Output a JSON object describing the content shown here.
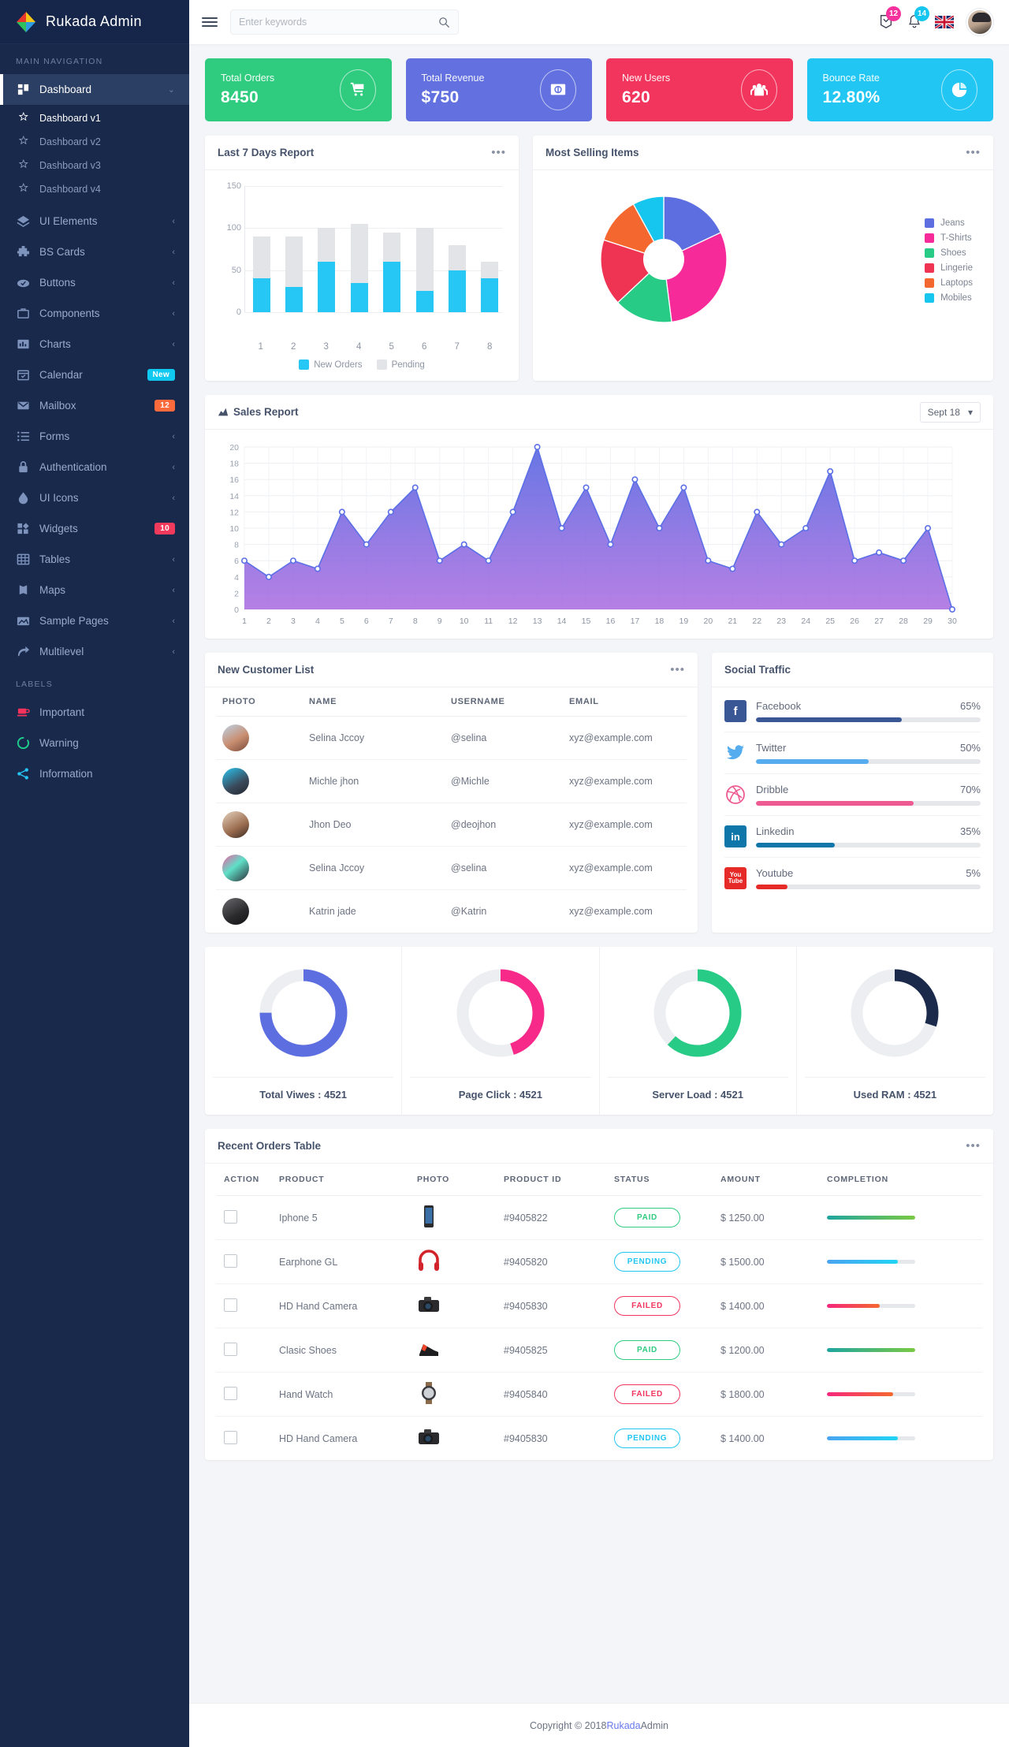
{
  "brand": {
    "title": "Rukada Admin",
    "logo_icon": "diamond-logo-icon"
  },
  "sidebar": {
    "nav_header": "MAIN NAVIGATION",
    "labels_header": "LABELS",
    "items": [
      {
        "label": "Dashboard",
        "icon": "dashboard-icon",
        "active": true,
        "caret": "⌄",
        "children": [
          {
            "label": "Dashboard v1",
            "icon": "star-icon",
            "active": true
          },
          {
            "label": "Dashboard v2",
            "icon": "star-icon",
            "active": false
          },
          {
            "label": "Dashboard v3",
            "icon": "star-icon",
            "active": false
          },
          {
            "label": "Dashboard v4",
            "icon": "star-icon",
            "active": false
          }
        ]
      },
      {
        "label": "UI Elements",
        "icon": "layers-icon",
        "caret": "‹"
      },
      {
        "label": "BS Cards",
        "icon": "puzzle-icon",
        "caret": "‹"
      },
      {
        "label": "Buttons",
        "icon": "cloud-check-icon",
        "caret": "‹"
      },
      {
        "label": "Components",
        "icon": "briefcase-icon",
        "caret": "‹"
      },
      {
        "label": "Charts",
        "icon": "bar-chart-icon",
        "caret": "‹"
      },
      {
        "label": "Calendar",
        "icon": "calendar-icon",
        "badge": "New",
        "badge_color": "#0fc9f0"
      },
      {
        "label": "Mailbox",
        "icon": "envelope-icon",
        "badge": "12",
        "badge_color": "#fd6a3b"
      },
      {
        "label": "Forms",
        "icon": "list-icon",
        "caret": "‹"
      },
      {
        "label": "Authentication",
        "icon": "lock-icon",
        "caret": "‹"
      },
      {
        "label": "UI Icons",
        "icon": "droplet-icon",
        "caret": "‹"
      },
      {
        "label": "Widgets",
        "icon": "widgets-icon",
        "badge": "10",
        "badge_color": "#f23a5c"
      },
      {
        "label": "Tables",
        "icon": "table-icon",
        "caret": "‹"
      },
      {
        "label": "Maps",
        "icon": "map-icon",
        "caret": "‹"
      },
      {
        "label": "Sample Pages",
        "icon": "images-icon",
        "caret": "‹"
      },
      {
        "label": "Multilevel",
        "icon": "arrow-forward-icon",
        "caret": "‹"
      }
    ],
    "labels": [
      {
        "label": "Important",
        "icon": "coffee-icon",
        "color": "#f5325c"
      },
      {
        "label": "Warning",
        "icon": "circle-notch-icon",
        "color": "#1fc98a"
      },
      {
        "label": "Information",
        "icon": "share-icon",
        "color": "#24c6f5"
      }
    ]
  },
  "topbar": {
    "menu_icon": "hamburger-icon",
    "search": {
      "placeholder": "Enter keywords",
      "value": "",
      "icon": "search-icon"
    },
    "mail": {
      "icon": "mail-icon",
      "badge": "12",
      "badge_color": "#f5319d"
    },
    "bell": {
      "icon": "bell-icon",
      "badge": "14",
      "badge_color": "#17c6ef"
    },
    "flag": {
      "icon": "uk-flag-icon"
    },
    "avatar": {
      "icon": "user-avatar"
    }
  },
  "stats": [
    {
      "title": "Total Orders",
      "value": "8450",
      "color": "#2fcb7f",
      "icon": "cart-icon"
    },
    {
      "title": "Total Revenue",
      "value": "$750",
      "color": "#6270e0",
      "icon": "money-icon"
    },
    {
      "title": "New Users",
      "value": "620",
      "color": "#f2355d",
      "icon": "users-icon"
    },
    {
      "title": "Bounce Rate",
      "value": "12.80%",
      "color": "#21c6f3",
      "icon": "pie-icon"
    }
  ],
  "panels": {
    "last7": {
      "title": "Last 7 Days Report",
      "menu_icon": "more-icon"
    },
    "most_selling": {
      "title": "Most Selling Items",
      "menu_icon": "more-icon"
    },
    "sales": {
      "title": "Sales Report",
      "icon": "area-chart-icon",
      "date_value": "Sept 18",
      "caret": "▾"
    },
    "customers": {
      "title": "New Customer List",
      "menu_icon": "more-icon"
    },
    "social": {
      "title": "Social Traffic"
    },
    "orders": {
      "title": "Recent Orders Table",
      "menu_icon": "more-icon"
    }
  },
  "chart_data": [
    {
      "type": "bar",
      "title": "Last 7 Days Report",
      "categories": [
        "1",
        "2",
        "3",
        "4",
        "5",
        "6",
        "7",
        "8"
      ],
      "stacked": true,
      "series": [
        {
          "name": "New Orders",
          "color": "#26c6f5",
          "values": [
            40,
            30,
            60,
            35,
            60,
            25,
            50,
            40
          ]
        },
        {
          "name": "Pending",
          "color": "#e2e4e7",
          "values": [
            50,
            60,
            40,
            70,
            35,
            75,
            30,
            20
          ]
        }
      ],
      "totals": [
        90,
        90,
        100,
        105,
        95,
        100,
        80,
        60
      ],
      "ylim": [
        0,
        150
      ],
      "yticks": [
        0,
        50,
        100,
        150
      ],
      "xlabel": "",
      "ylabel": "",
      "grid": true,
      "legend": "bottom"
    },
    {
      "type": "pie",
      "title": "Most Selling Items",
      "donut": true,
      "legend": "right",
      "labels": [
        "Jeans",
        "T-Shirts",
        "Shoes",
        "Lingerie",
        "Laptops",
        "Mobiles"
      ],
      "values": [
        18,
        30,
        15,
        17,
        12,
        8
      ],
      "colors": [
        "#5d6fe0",
        "#f72a9a",
        "#28cb86",
        "#ef3353",
        "#f4682f",
        "#17c6ef"
      ]
    },
    {
      "type": "area",
      "title": "Sales Report",
      "x": [
        1,
        2,
        3,
        4,
        5,
        6,
        7,
        8,
        9,
        10,
        11,
        12,
        13,
        14,
        15,
        16,
        17,
        18,
        19,
        20,
        21,
        22,
        23,
        24,
        25,
        26,
        27,
        28,
        29,
        30
      ],
      "values": [
        6,
        4,
        6,
        5,
        12,
        8,
        12,
        15,
        6,
        8,
        6,
        12,
        20,
        10,
        15,
        8,
        16,
        10,
        15,
        6,
        5,
        12,
        8,
        10,
        17,
        6,
        7,
        6,
        10,
        0
      ],
      "ylim": [
        0,
        20
      ],
      "yticks": [
        0,
        2,
        4,
        6,
        8,
        10,
        12,
        14,
        16,
        18,
        20
      ],
      "line_color": "#5b6fe6",
      "fill_from": "#5f6fe3",
      "fill_to": "#a86ae0",
      "xlabel": "",
      "ylabel": "",
      "grid": true,
      "legend": "none"
    }
  ],
  "customer_table": {
    "columns": [
      "PHOTO",
      "NAME",
      "USERNAME",
      "EMAIL"
    ],
    "rows": [
      {
        "name": "Selina Jccoy",
        "username": "@selina",
        "email": "xyz@example.com",
        "avatar": "avatar-woman-redhair"
      },
      {
        "name": "Michle jhon",
        "username": "@Michle",
        "email": "xyz@example.com",
        "avatar": "avatar-man-glasses"
      },
      {
        "name": "Jhon Deo",
        "username": "@deojhon",
        "email": "xyz@example.com",
        "avatar": "avatar-woman-brown"
      },
      {
        "name": "Selina Jccoy",
        "username": "@selina",
        "email": "xyz@example.com",
        "avatar": "avatar-man-colorful"
      },
      {
        "name": "Katrin jade",
        "username": "@Katrin",
        "email": "xyz@example.com",
        "avatar": "avatar-woman-dark"
      }
    ]
  },
  "social_traffic": [
    {
      "name": "Facebook",
      "percent": "65%",
      "value": 65,
      "color": "#3a5795",
      "icon": "facebook-icon"
    },
    {
      "name": "Twitter",
      "percent": "50%",
      "value": 50,
      "color": "#55acee",
      "icon": "twitter-icon"
    },
    {
      "name": "Dribble",
      "percent": "70%",
      "value": 70,
      "color": "#ed5b92",
      "icon": "dribbble-icon"
    },
    {
      "name": "Linkedin",
      "percent": "35%",
      "value": 35,
      "color": "#0e76a8",
      "icon": "linkedin-icon"
    },
    {
      "name": "Youtube",
      "percent": "5%",
      "value": 14,
      "color": "#e62a28",
      "icon": "youtube-icon"
    }
  ],
  "gauges": [
    {
      "label": "Total Viwes : 4521",
      "value": 75,
      "color": "#5d6fe0"
    },
    {
      "label": "Page Click : 4521",
      "value": 45,
      "color": "#f72a8a"
    },
    {
      "label": "Server Load : 4521",
      "value": 62,
      "color": "#28cb86"
    },
    {
      "label": "Used RAM : 4521",
      "value": 30,
      "color": "#1b2a4a"
    }
  ],
  "orders_table": {
    "columns": [
      "ACTION",
      "PRODUCT",
      "PHOTO",
      "PRODUCT ID",
      "STATUS",
      "AMOUNT",
      "COMPLETION"
    ],
    "rows": [
      {
        "product": "Iphone 5",
        "photo": "phone-icon",
        "id": "#9405822",
        "status": "PAID",
        "status_color": "#2fcb7f",
        "amount": "$ 1250.00",
        "completion": 100,
        "bar_from": "#1fa5a0",
        "bar_to": "#7ac943"
      },
      {
        "product": "Earphone GL",
        "photo": "headset-icon",
        "id": "#9405820",
        "status": "PENDING",
        "status_color": "#21c6f3",
        "amount": "$ 1500.00",
        "completion": 80,
        "bar_from": "#4aa3f0",
        "bar_to": "#21d4f5"
      },
      {
        "product": "HD Hand Camera",
        "photo": "camera-icon",
        "id": "#9405830",
        "status": "FAILED",
        "status_color": "#f2355d",
        "amount": "$ 1400.00",
        "completion": 60,
        "bar_from": "#f5277d",
        "bar_to": "#f4682f"
      },
      {
        "product": "Clasic Shoes",
        "photo": "shoe-icon",
        "id": "#9405825",
        "status": "PAID",
        "status_color": "#2fcb7f",
        "amount": "$ 1200.00",
        "completion": 100,
        "bar_from": "#1fa5a0",
        "bar_to": "#7ac943"
      },
      {
        "product": "Hand Watch",
        "photo": "watch-icon",
        "id": "#9405840",
        "status": "FAILED",
        "status_color": "#f2355d",
        "amount": "$ 1800.00",
        "completion": 75,
        "bar_from": "#f5277d",
        "bar_to": "#f4682f"
      },
      {
        "product": "HD Hand Camera",
        "photo": "camera-icon",
        "id": "#9405830",
        "status": "PENDING",
        "status_color": "#21c6f3",
        "amount": "$ 1400.00",
        "completion": 80,
        "bar_from": "#4aa3f0",
        "bar_to": "#21d4f5"
      }
    ]
  },
  "footer": {
    "prefix": "Copyright © 2018 ",
    "accent": "Rukada",
    "suffix": " Admin"
  }
}
